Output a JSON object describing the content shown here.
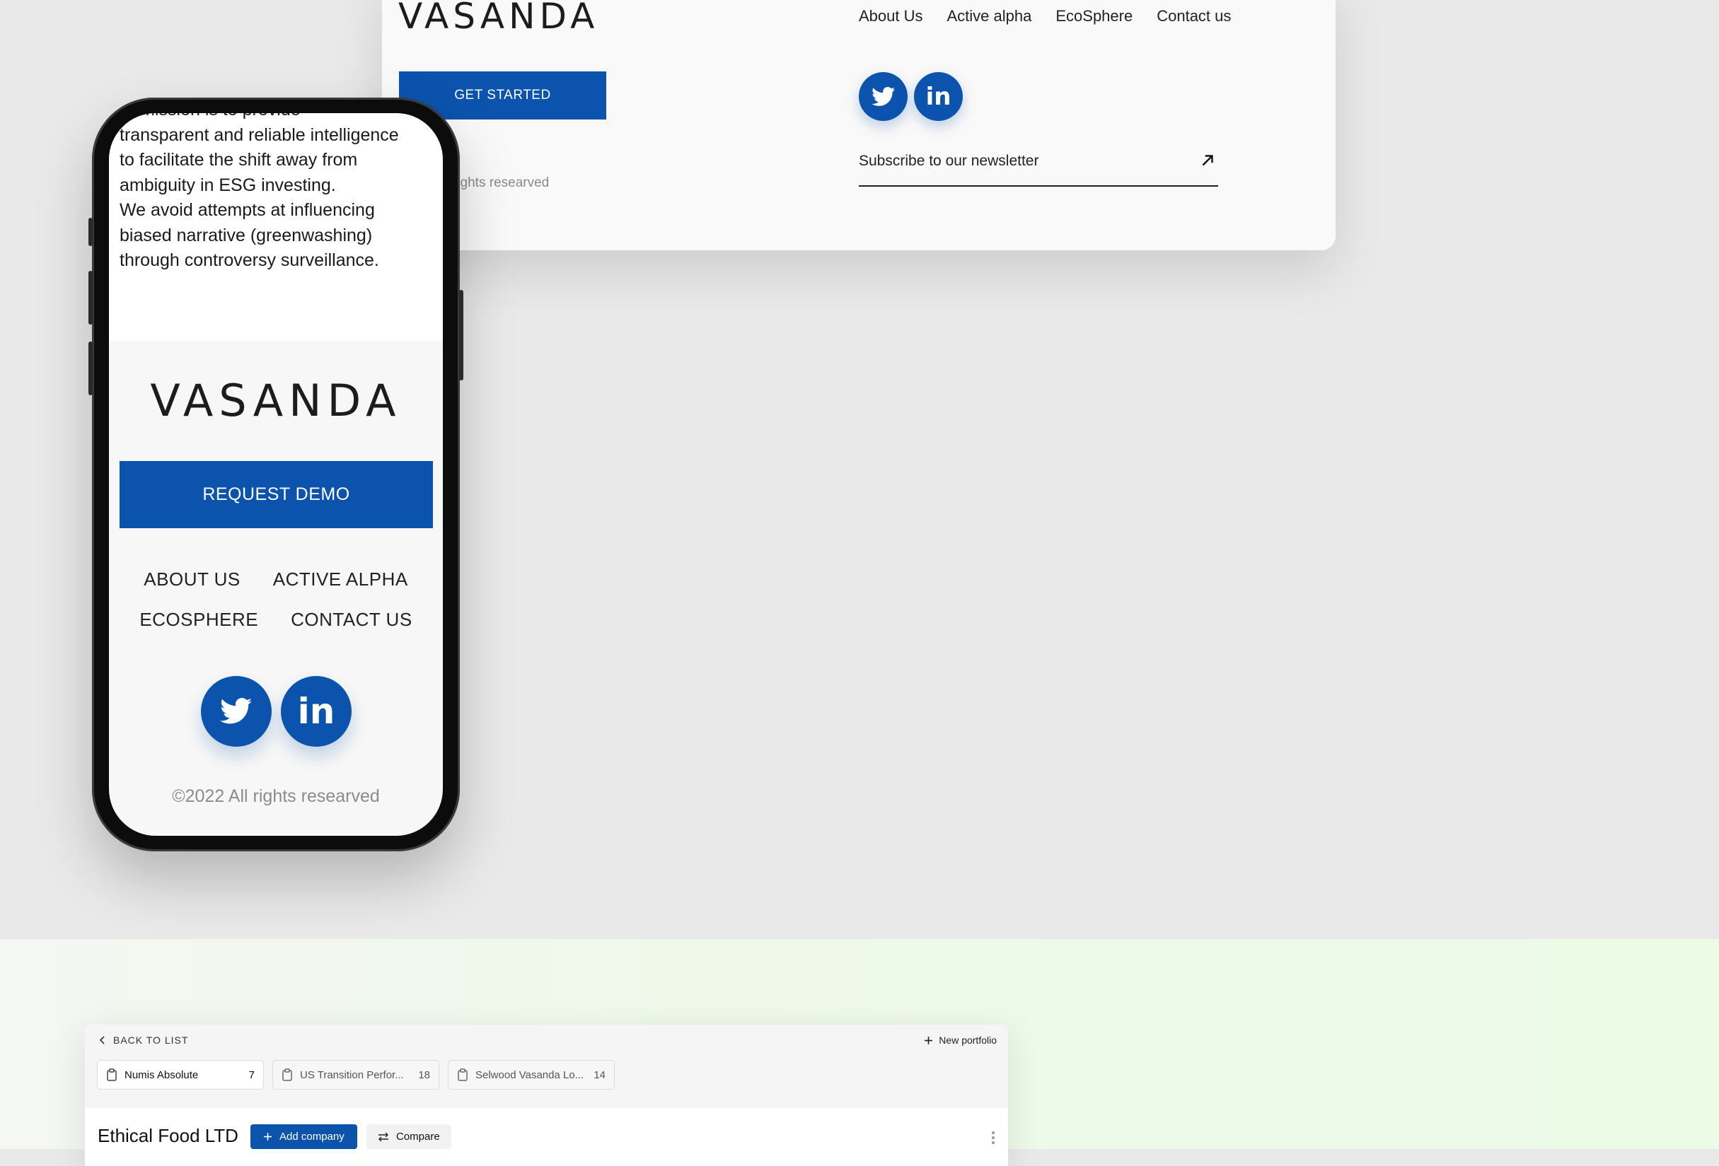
{
  "desktop_footer": {
    "logo": "VASANDA",
    "nav": [
      "About Us",
      "Active alpha",
      "EcoSphere",
      "Contact us"
    ],
    "cta_label": "GET STARTED",
    "rights_text": "rights researved",
    "newsletter_label": "Subscribe to our newsletter",
    "icons": {
      "twitter": "twitter-icon",
      "linkedin": "linkedin-icon",
      "arrow": "arrow-up-right-icon"
    }
  },
  "mobile": {
    "mission_lines": [
      "ur mission is to provide",
      "transparent and reliable intelligence",
      "to facilitate the shift away from",
      "ambiguity in ESG investing.",
      "We avoid attempts at influencing",
      "biased narrative (greenwashing)",
      "through controversy surveillance."
    ],
    "logo": "VASANDA",
    "cta_label": "REQUEST DEMO",
    "nav": [
      "ABOUT US",
      "ACTIVE ALPHA",
      "ECOSPHERE",
      "CONTACT US"
    ],
    "linkedin_text": "in",
    "rights_text": "©2022 All rights researved"
  },
  "app": {
    "back_label": "BACK TO LIST",
    "new_portfolio_label": "New portfolio",
    "tabs": [
      {
        "name": "Numis Absolute",
        "count": "7",
        "active": true
      },
      {
        "name": "US Transition Perfor...",
        "count": "18",
        "active": false
      },
      {
        "name": "Selwood Vasanda Lo...",
        "count": "14",
        "active": false
      }
    ],
    "company_name": "Ethical Food LTD",
    "add_company_label": "Add company",
    "compare_label": "Compare"
  },
  "colors": {
    "brand_blue": "#0b53ad",
    "background": "#e9e9e9",
    "band_green": "#ecfbe6"
  }
}
